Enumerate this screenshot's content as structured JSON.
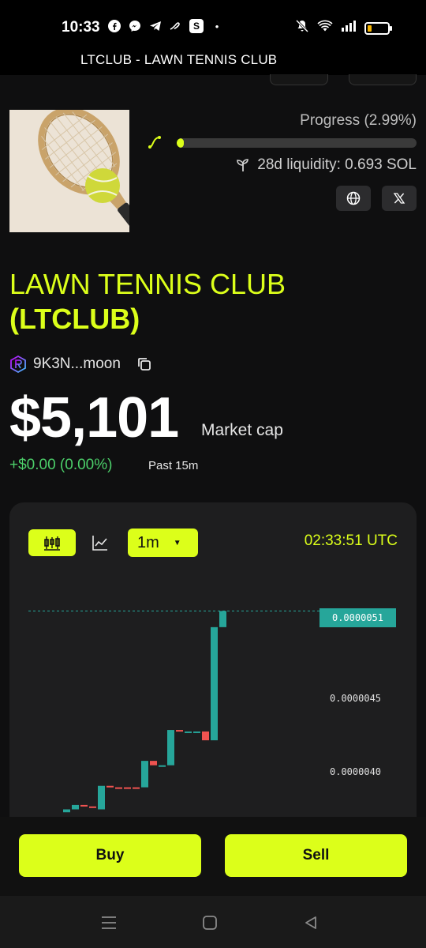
{
  "status_bar": {
    "time": "10:33"
  },
  "app": {
    "title": "LTCLUB - LAWN TENNIS CLUB"
  },
  "token": {
    "name": "LAWN TENNIS CLUB",
    "ticker": "(LTCLUB)",
    "image_alt": "tennis racket and ball",
    "address": "9K3N...moon"
  },
  "progress": {
    "label": "Progress (2.99%)",
    "fraction": 0.0299
  },
  "liquidity": {
    "label": "28d liquidity: 0.693 SOL"
  },
  "market": {
    "cap": "$5,101",
    "cap_label": "Market cap",
    "change": "+$0.00 (0.00%)",
    "change_window": "Past 15m"
  },
  "chart_toolbar": {
    "interval": "1m",
    "time": "02:33:51 UTC"
  },
  "chart_data": {
    "type": "candlestick",
    "current_price": "0.0000051",
    "current_price_value": 5.1e-06,
    "y_tick_labels": [
      "0.0000045",
      "0.0000040"
    ],
    "y_ticks": [
      4.5e-06,
      4e-06
    ],
    "candles": [
      {
        "o": 3.73e-06,
        "c": 3.75e-06,
        "dir": "up"
      },
      {
        "o": 3.75e-06,
        "c": 3.78e-06,
        "dir": "up"
      },
      {
        "o": 3.78e-06,
        "c": 3.77e-06,
        "dir": "down"
      },
      {
        "o": 3.77e-06,
        "c": 3.76e-06,
        "dir": "down"
      },
      {
        "o": 3.75e-06,
        "c": 3.91e-06,
        "dir": "up"
      },
      {
        "o": 3.91e-06,
        "c": 3.9e-06,
        "dir": "down"
      },
      {
        "o": 3.9e-06,
        "c": 3.9e-06,
        "dir": "down"
      },
      {
        "o": 3.9e-06,
        "c": 3.9e-06,
        "dir": "down"
      },
      {
        "o": 3.9e-06,
        "c": 3.9e-06,
        "dir": "down"
      },
      {
        "o": 3.9e-06,
        "c": 4.08e-06,
        "dir": "up"
      },
      {
        "o": 4.08e-06,
        "c": 4.05e-06,
        "dir": "down"
      },
      {
        "o": 4.05e-06,
        "c": 4.05e-06,
        "dir": "up"
      },
      {
        "o": 4.05e-06,
        "c": 4.29e-06,
        "dir": "up"
      },
      {
        "o": 4.29e-06,
        "c": 4.28e-06,
        "dir": "down"
      },
      {
        "o": 4.28e-06,
        "c": 4.27e-06,
        "dir": "up"
      },
      {
        "o": 4.27e-06,
        "c": 4.28e-06,
        "dir": "up"
      },
      {
        "o": 4.28e-06,
        "c": 4.22e-06,
        "dir": "down"
      },
      {
        "o": 4.22e-06,
        "c": 4.99e-06,
        "dir": "up"
      },
      {
        "o": 4.99e-06,
        "c": 5.1e-06,
        "dir": "up"
      }
    ],
    "colors": {
      "up": "#26a69a",
      "down": "#ef5350"
    }
  },
  "actions": {
    "buy": "Buy",
    "sell": "Sell"
  },
  "colors": {
    "accent": "#dcff1a",
    "background": "#0f0f10",
    "positive": "#4ccf6a"
  }
}
